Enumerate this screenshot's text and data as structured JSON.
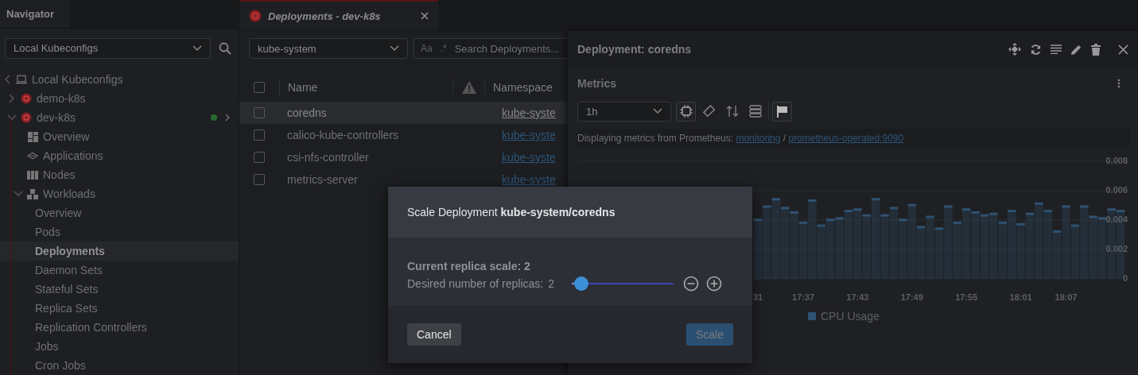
{
  "sidebar": {
    "tab": "Navigator",
    "context_select": {
      "value": "Local Kubeconfigs"
    },
    "tree": [
      {
        "label": "Local Kubeconfigs",
        "kind": "root",
        "selected": false,
        "children": [
          {
            "label": "demo-k8s",
            "kind": "cluster",
            "selected": false,
            "expanded": false,
            "connected": false
          },
          {
            "label": "dev-k8s",
            "kind": "cluster",
            "selected": false,
            "expanded": true,
            "connected": true,
            "children": [
              {
                "label": "Overview",
                "kind": "section",
                "selected": false
              },
              {
                "label": "Applications",
                "kind": "section",
                "selected": false
              },
              {
                "label": "Nodes",
                "kind": "section",
                "selected": false
              },
              {
                "label": "Workloads",
                "kind": "section",
                "selected": false,
                "expanded": true,
                "children": [
                  {
                    "label": "Overview",
                    "kind": "item",
                    "selected": false
                  },
                  {
                    "label": "Pods",
                    "kind": "item",
                    "selected": false
                  },
                  {
                    "label": "Deployments",
                    "kind": "item",
                    "selected": true
                  },
                  {
                    "label": "Daemon Sets",
                    "kind": "item",
                    "selected": false
                  },
                  {
                    "label": "Stateful Sets",
                    "kind": "item",
                    "selected": false
                  },
                  {
                    "label": "Replica Sets",
                    "kind": "item",
                    "selected": false
                  },
                  {
                    "label": "Replication Controllers",
                    "kind": "item",
                    "selected": false
                  },
                  {
                    "label": "Jobs",
                    "kind": "item",
                    "selected": false
                  },
                  {
                    "label": "Cron Jobs",
                    "kind": "item",
                    "selected": false
                  }
                ]
              }
            ]
          }
        ]
      }
    ]
  },
  "tabs": [
    {
      "label": "Deployments - dev-k8s",
      "selected": true
    }
  ],
  "table": {
    "namespace_select": {
      "value": "kube-system"
    },
    "search": {
      "toggles": [
        "Aa",
        ".*"
      ],
      "placeholder": "Search Deployments..."
    },
    "header_checked": false,
    "columns": [
      "Name",
      "Namespace"
    ],
    "rows": [
      {
        "name": "coredns",
        "namespace": "kube-syste",
        "checked": false,
        "selected": true
      },
      {
        "name": "calico-kube-controllers",
        "namespace": "kube-syste",
        "checked": false,
        "selected": false
      },
      {
        "name": "csi-nfs-controller",
        "namespace": "kube-syste",
        "checked": false,
        "selected": false
      },
      {
        "name": "metrics-server",
        "namespace": "kube-syste",
        "checked": false,
        "selected": false
      }
    ]
  },
  "details": {
    "title": "Deployment: coredns",
    "metrics": {
      "heading": "Metrics",
      "range_select": {
        "value": "1h"
      },
      "tools": [
        {
          "selected": true
        },
        {
          "selected": false
        },
        {
          "selected": false
        },
        {
          "selected": false
        },
        {
          "selected": true
        }
      ],
      "source": {
        "prefix": "Displaying metrics from Prometheus:",
        "namespace_link": "monitoring",
        "separator": "/",
        "service_link": "prometheus-operated:9090"
      },
      "chart_data": {
        "type": "bar",
        "categories": [
          "31",
          null,
          null,
          null,
          null,
          "17:37",
          null,
          null,
          null,
          null,
          null,
          "17:43",
          null,
          null,
          null,
          null,
          null,
          "17:49",
          null,
          null,
          null,
          null,
          null,
          "17:55",
          null,
          null,
          null,
          null,
          null,
          "18:01",
          null,
          null,
          null,
          null,
          "18:07",
          null,
          null,
          null,
          null,
          null,
          null
        ],
        "ylim": [
          0,
          0.008
        ],
        "grid": true,
        "yticks": [
          0,
          0.002,
          0.004,
          0.006,
          0.008
        ],
        "series": [
          {
            "name": "CPU Usage",
            "color": "#2f5272",
            "values": [
              0.0041,
              0.005,
              0.0055,
              0.0049,
              0.0046,
              0.0039,
              0.0054,
              0.0037,
              0.0041,
              0.0042,
              0.0047,
              0.0048,
              0.0044,
              0.0055,
              0.0044,
              0.0049,
              0.0041,
              0.0051,
              0.0036,
              0.0043,
              0.0035,
              0.005,
              0.0039,
              0.0048,
              0.0046,
              0.0044,
              0.0045,
              0.0039,
              0.0047,
              0.0038,
              0.0045,
              0.0052,
              0.0047,
              0.0033,
              0.005,
              0.0037,
              0.005,
              0.0043,
              0.0042,
              0.0048,
              0.0047
            ]
          }
        ]
      }
    }
  },
  "dialog": {
    "title": "Scale Deployment **kube-system/coredns**",
    "current": "Current replica scale: 2",
    "desired_label": "Desired number of replicas:",
    "desired_value": "2",
    "slider": {
      "level": 0.03
    },
    "buttons": [
      {
        "label": "Cancel",
        "kind": "secondary",
        "disabled": false
      },
      {
        "label": "Scale",
        "kind": "primary",
        "disabled": true
      }
    ]
  }
}
